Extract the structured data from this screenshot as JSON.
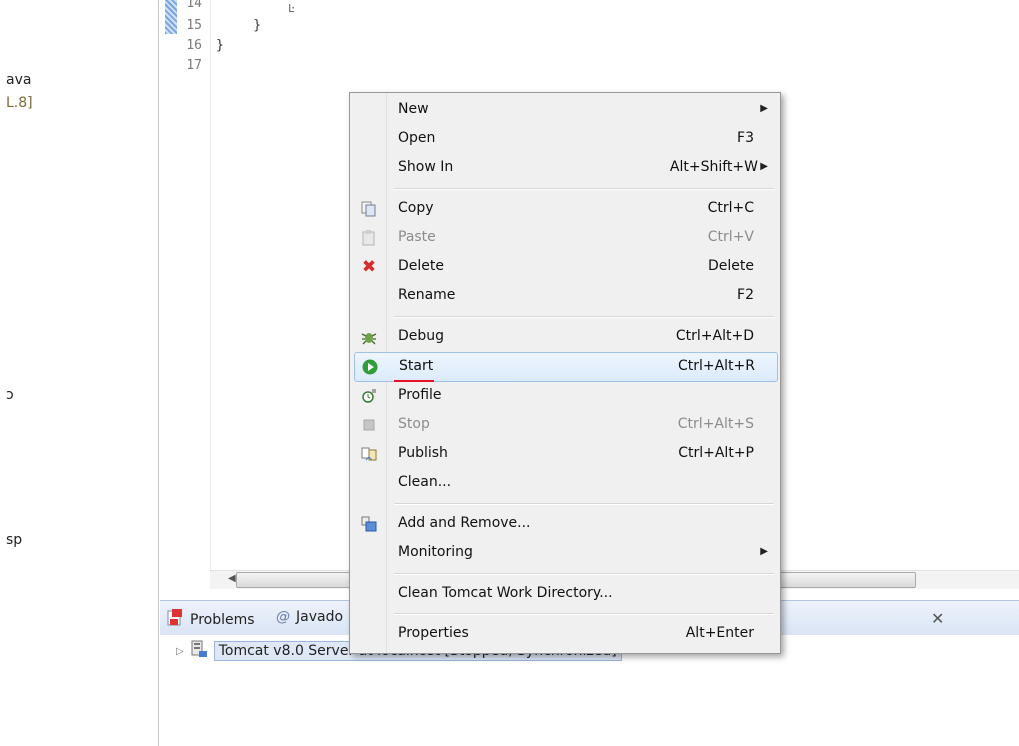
{
  "sidebar_fragments": [
    "ava",
    "L.8]",
    "ɔ",
    "sp"
  ],
  "editor": {
    "lines": [
      {
        "num": "14",
        "code": ""
      },
      {
        "num": "15",
        "code": "    }"
      },
      {
        "num": "16",
        "code": "}"
      },
      {
        "num": "17",
        "code": ""
      }
    ],
    "top_fragment": "Ŀ"
  },
  "context_menu": {
    "items": [
      {
        "label": "New",
        "shortcut": "",
        "submenu": true,
        "icon": "",
        "disabled": false
      },
      {
        "label": "Open",
        "shortcut": "F3",
        "submenu": false,
        "icon": "",
        "disabled": false
      },
      {
        "label": "Show In",
        "shortcut": "Alt+Shift+W",
        "submenu": true,
        "icon": "",
        "disabled": false
      },
      {
        "label": "Copy",
        "shortcut": "Ctrl+C",
        "submenu": false,
        "icon": "copy-icon",
        "disabled": false
      },
      {
        "label": "Paste",
        "shortcut": "Ctrl+V",
        "submenu": false,
        "icon": "paste-icon",
        "disabled": true
      },
      {
        "label": "Delete",
        "shortcut": "Delete",
        "submenu": false,
        "icon": "delete-icon",
        "disabled": false
      },
      {
        "label": "Rename",
        "shortcut": "F2",
        "submenu": false,
        "icon": "",
        "disabled": false
      },
      {
        "label": "Debug",
        "shortcut": "Ctrl+Alt+D",
        "submenu": false,
        "icon": "debug-icon",
        "disabled": false
      },
      {
        "label": "Start",
        "shortcut": "Ctrl+Alt+R",
        "submenu": false,
        "icon": "start-icon",
        "disabled": false,
        "highlighted": true
      },
      {
        "label": "Profile",
        "shortcut": "",
        "submenu": false,
        "icon": "profile-icon",
        "disabled": false
      },
      {
        "label": "Stop",
        "shortcut": "Ctrl+Alt+S",
        "submenu": false,
        "icon": "stop-icon",
        "disabled": true
      },
      {
        "label": "Publish",
        "shortcut": "Ctrl+Alt+P",
        "submenu": false,
        "icon": "publish-icon",
        "disabled": false
      },
      {
        "label": "Clean...",
        "shortcut": "",
        "submenu": false,
        "icon": "",
        "disabled": false
      },
      {
        "label": "Add and Remove...",
        "shortcut": "",
        "submenu": false,
        "icon": "add-remove-icon",
        "disabled": false
      },
      {
        "label": "Monitoring",
        "shortcut": "",
        "submenu": true,
        "icon": "",
        "disabled": false
      },
      {
        "label": "Clean Tomcat Work Directory...",
        "shortcut": "",
        "submenu": false,
        "icon": "",
        "disabled": false
      },
      {
        "label": "Properties",
        "shortcut": "Alt+Enter",
        "submenu": false,
        "icon": "",
        "disabled": false
      }
    ]
  },
  "bottom_panel": {
    "tabs": [
      {
        "label": "Problems",
        "icon": "problems-icon"
      },
      {
        "label": "Javado",
        "icon": "at-icon"
      }
    ],
    "server_row": "Tomcat v8.0 Server at localhost  [Stopped, Synchronized]"
  },
  "colors": {
    "highlight_border": "#9ec2ea",
    "underline_red": "#e81123",
    "panel_tab_bg": "#d9e4f5"
  }
}
